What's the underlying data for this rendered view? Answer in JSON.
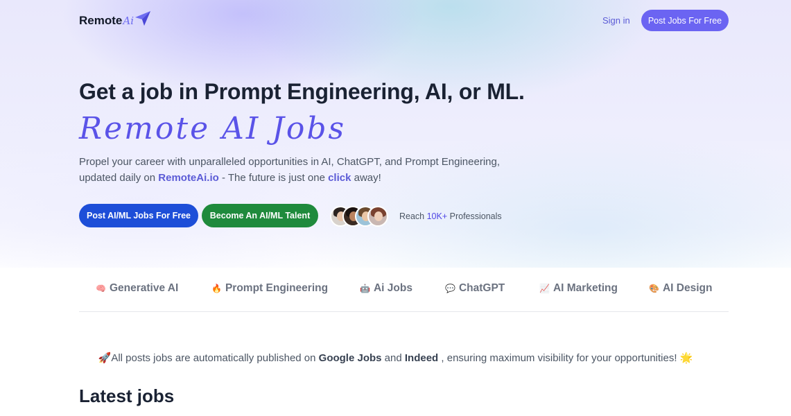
{
  "nav": {
    "logo_text": "Remote",
    "logo_script": "Ai",
    "sign_in": "Sign in",
    "post_jobs_button": "Post Jobs For Free"
  },
  "hero": {
    "headline": "Get a job in Prompt Engineering, AI, or ML.",
    "script_title": "Remote AI Jobs",
    "description_part1": "Propel your career with unparalleled opportunities in AI, ChatGPT, and Prompt Engineering, updated daily on ",
    "description_site": "RemoteAi.io",
    "description_part2": " - The future is just one ",
    "description_click": "click",
    "description_part3": " away!",
    "post_button": "Post AI/ML Jobs For Free",
    "talent_button": "Become An AI/ML Talent",
    "reach_prefix": "Reach ",
    "reach_number": "10K+",
    "reach_suffix": " Professionals"
  },
  "tabs": [
    {
      "emoji": "🧠",
      "label": "Generative AI"
    },
    {
      "emoji": "🔥",
      "label": "Prompt Engineering"
    },
    {
      "emoji": "🤖",
      "label": "Ai Jobs"
    },
    {
      "emoji": "💬",
      "label": "ChatGPT"
    },
    {
      "emoji": "📈",
      "label": "AI Marketing"
    },
    {
      "emoji": "🎨",
      "label": "AI Design"
    }
  ],
  "notice": {
    "lead_emoji": "🚀",
    "part1": "All posts jobs are automatically published on ",
    "google": "Google Jobs",
    "and": " and ",
    "indeed": "Indeed",
    "part2": " , ensuring maximum visibility for your opportunities! ",
    "trail_emoji": "🌟"
  },
  "latest_title": "Latest jobs",
  "colors": {
    "accent": "#6b64f2",
    "primary_blue": "#1d4ed8",
    "talent_green": "#1f8a3c",
    "script_purple": "#5a53e8"
  }
}
